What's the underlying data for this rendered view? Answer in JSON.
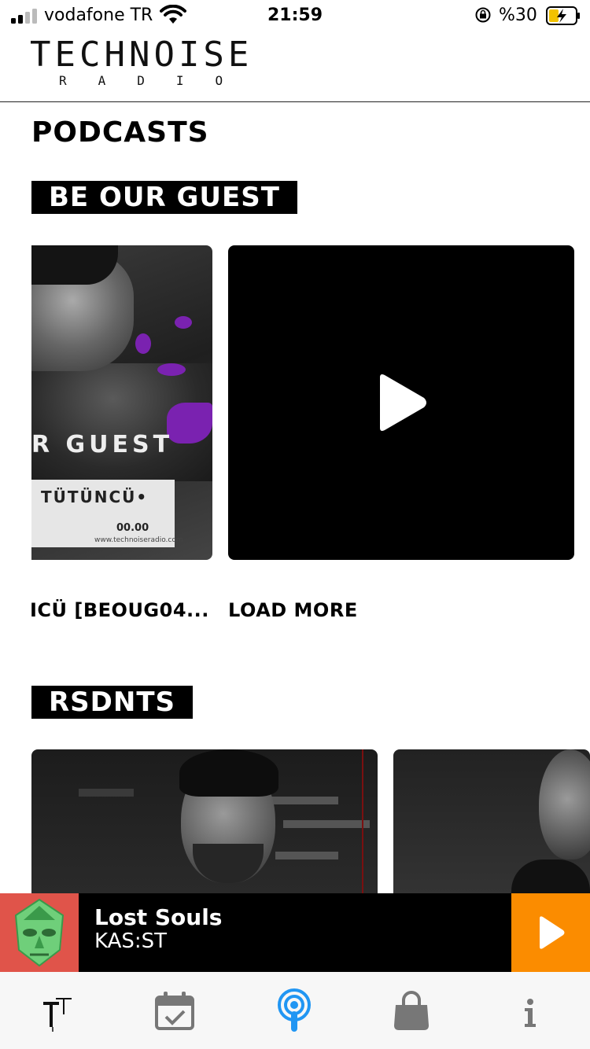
{
  "status_bar": {
    "carrier": "vodafone TR",
    "time": "21:59",
    "battery_percent": "%30",
    "signal_bars": 2,
    "icons": [
      "signal-icon",
      "wifi-icon",
      "rotation-lock-icon",
      "battery-charging-icon"
    ]
  },
  "header": {
    "logo_main": "TECHNOISE",
    "logo_sub": "RADIO"
  },
  "page_title": "PODCASTS",
  "sections": {
    "guest": {
      "label": "BE OUR GUEST",
      "cards": [
        {
          "overlay_text": "R GUEST",
          "artist_text": "TÜTÜNCÜ•",
          "time_text": "00.00",
          "url_text": "www.technoiseradio.com",
          "caption": "ICÜ [BEOUG04..."
        },
        {
          "type": "video",
          "caption": "LOAD MORE"
        }
      ]
    },
    "residents": {
      "label": "RSDNTS"
    }
  },
  "player": {
    "title": "Lost Souls",
    "artist": "KAS:ST",
    "accent_color": "#fb8c00",
    "art_background": "#e0544a"
  },
  "tabbar": {
    "tabs": [
      {
        "icon": "technoise-logo-icon",
        "active": false
      },
      {
        "icon": "calendar-check-icon",
        "active": false
      },
      {
        "icon": "podcast-icon",
        "active": true
      },
      {
        "icon": "shopping-bag-icon",
        "active": false
      },
      {
        "icon": "info-icon",
        "active": false
      }
    ],
    "active_color": "#2196f3",
    "inactive_color": "#777777"
  }
}
